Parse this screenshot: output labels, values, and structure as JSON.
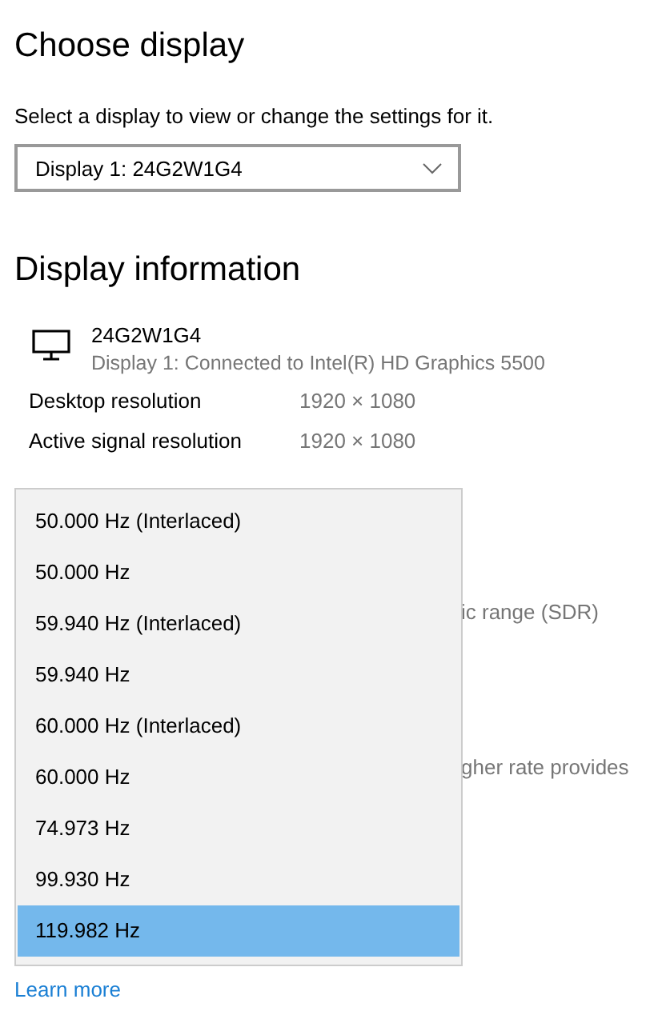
{
  "choose_display": {
    "title": "Choose display",
    "caption": "Select a display to view or change the settings for it.",
    "dropdown": {
      "value": "Display 1: 24G2W1G4"
    }
  },
  "display_information": {
    "title": "Display information",
    "monitor": {
      "name": "24G2W1G4",
      "subtitle": "Display 1: Connected to Intel(R) HD Graphics 5500"
    },
    "rows": [
      {
        "label": "Desktop resolution",
        "value": "1920 × 1080"
      },
      {
        "label": "Active signal resolution",
        "value": "1920 × 1080"
      }
    ],
    "partial_texts": [
      "ic range (SDR)",
      "gher rate provides"
    ]
  },
  "refresh_rate_list": [
    {
      "label": "50.000 Hz (Interlaced)",
      "selected": false
    },
    {
      "label": "50.000 Hz",
      "selected": false
    },
    {
      "label": "59.940 Hz (Interlaced)",
      "selected": false
    },
    {
      "label": "59.940 Hz",
      "selected": false
    },
    {
      "label": "60.000 Hz (Interlaced)",
      "selected": false
    },
    {
      "label": "60.000 Hz",
      "selected": false
    },
    {
      "label": "74.973 Hz",
      "selected": false
    },
    {
      "label": "99.930 Hz",
      "selected": false
    },
    {
      "label": "119.982 Hz",
      "selected": true
    }
  ],
  "learn_more": "Learn more"
}
